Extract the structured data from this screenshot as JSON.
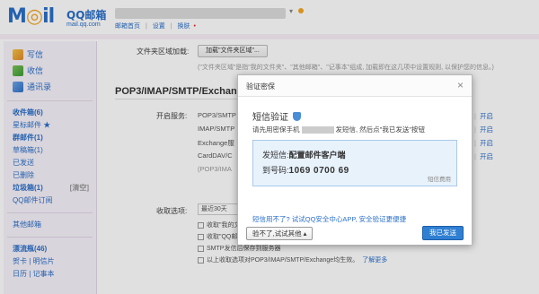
{
  "header": {
    "logo": "M",
    "logo_mid": "il",
    "brand": "QQ邮箱",
    "brand_url": "mail.qq.com",
    "nav": [
      "邮箱首页",
      "设置",
      "换肤"
    ],
    "nav_sep": "|"
  },
  "sidebar": {
    "quick": [
      {
        "label": "写信",
        "icon": "write-icon"
      },
      {
        "label": "收信",
        "icon": "inbox-icon"
      },
      {
        "label": "通讯录",
        "icon": "contacts-icon"
      }
    ],
    "folders": [
      {
        "label": "收件箱(6)",
        "bold": true
      },
      {
        "label": "星标邮件 ★",
        "bold": false
      },
      {
        "label": "群邮件(1)",
        "bold": true
      },
      {
        "label": "草稿箱(1)",
        "bold": false
      },
      {
        "label": "已发送",
        "bold": false
      },
      {
        "label": "已删除",
        "bold": false
      },
      {
        "label": "垃圾箱(1)",
        "bold": true,
        "tag": "[清空]"
      },
      {
        "label": "QQ邮件订阅",
        "bold": false
      },
      {
        "label": "其他邮箱",
        "bold": false
      },
      {
        "label": "漂流瓶(46)",
        "bold": true
      },
      {
        "label": "贺卡 | 明信片",
        "bold": false
      },
      {
        "label": "日历 | 记事本",
        "bold": false
      }
    ]
  },
  "main": {
    "folder_area_label": "文件夹区域加载:",
    "add_folder_btn": "加载\"文件夹区域\"...",
    "hint": "(\"文件夹区域\"是指\"我的文件夹\"、\"其他邮箱\"、\"记事本\"组成, 加载即在这几项中设置规则, 以保护您的信息。)",
    "section_title": "POP3/IMAP/SMTP/Exchang",
    "services_label": "开启服务:",
    "services": [
      {
        "name": "POP3/SMTP",
        "action": "开启"
      },
      {
        "name": "IMAP/SMTP",
        "action": "开启"
      },
      {
        "name": "Exchange服",
        "action": "开启"
      },
      {
        "name": "CardDAV/C",
        "action": "开启"
      },
      {
        "name": "(POP3/IMA",
        "action": ""
      }
    ],
    "recv_label": "收取选项:",
    "recv_select": "最近30天",
    "options": [
      {
        "text": "收取\"我的文件夹\"",
        "link": ""
      },
      {
        "text": "收取\"QQ邮件订阅\"",
        "link": ""
      },
      {
        "text": "SMTP发信后保存到服务器",
        "link": ""
      },
      {
        "text": "以上收取选项对POP3/IMAP/SMTP/Exchange均生效。",
        "link": "了解更多"
      }
    ]
  },
  "dialog": {
    "title": "验证密保",
    "close": "×",
    "sms_title": "短信验证",
    "desc_before": "请先用密保手机",
    "desc_after": "发短信, 然后点\"我已发送\"按钮",
    "content_label": "发短信:",
    "content_value": "配置邮件客户端",
    "number_label": "到号码:",
    "number_value": "1069 0700 69",
    "fee": "短信费用",
    "cant_send": "短信用不了? 试试QQ安全中心APP, 安全验证更便捷",
    "alt_button": "验不了,试试其他 ▴",
    "sent_button": "我已发送"
  }
}
